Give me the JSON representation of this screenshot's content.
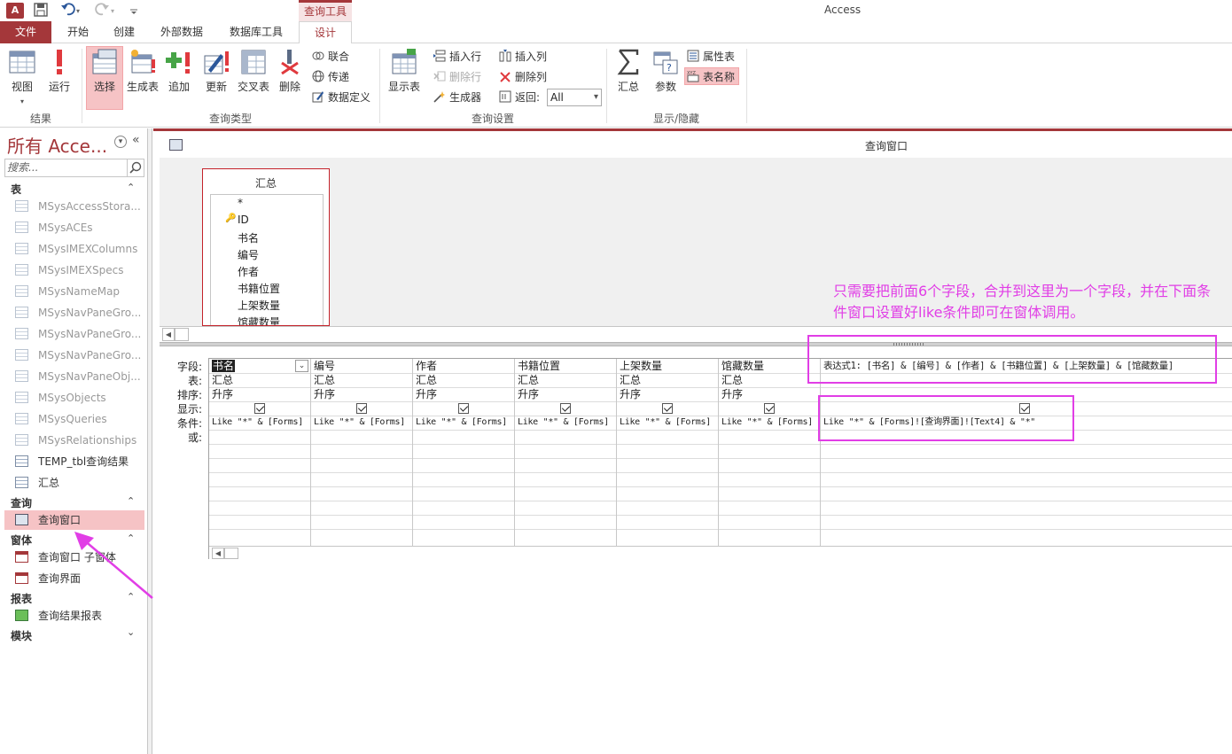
{
  "window": {
    "app_logo": "A",
    "title": "Access",
    "context_tab_header": "查询工具"
  },
  "quick_access": {
    "save_icon": "save-icon",
    "undo_icon": "undo-icon",
    "redo_icon": "redo-icon",
    "customize_icon": "customize-icon"
  },
  "tabs": [
    {
      "label": "文件"
    },
    {
      "label": "开始"
    },
    {
      "label": "创建"
    },
    {
      "label": "外部数据"
    },
    {
      "label": "数据库工具"
    },
    {
      "label": "设计"
    }
  ],
  "ribbon": {
    "results": {
      "label": "结果",
      "view": "视图",
      "run": "运行"
    },
    "query_type": {
      "label": "查询类型",
      "select": "选择",
      "make_table": "生成表",
      "append": "追加",
      "update": "更新",
      "crosstab": "交叉表",
      "delete": "删除",
      "union": "联合",
      "passthrough": "传递",
      "data_definition": "数据定义"
    },
    "query_setup": {
      "label": "查询设置",
      "show_table": "显示表",
      "insert_rows": "插入行",
      "delete_rows": "删除行",
      "builder": "生成器",
      "insert_columns": "插入列",
      "delete_columns": "删除列",
      "return_label": "返回:",
      "return_value": "All"
    },
    "show_hide": {
      "label": "显示/隐藏",
      "totals": "汇总",
      "parameters": "参数",
      "property_sheet": "属性表",
      "table_names": "表名称"
    }
  },
  "nav": {
    "title": "所有 Acce...",
    "search_placeholder": "搜索...",
    "sections": {
      "tables": "表",
      "queries": "查询",
      "forms": "窗体",
      "reports": "报表",
      "modules": "模块"
    },
    "tables": [
      "MSysAccessStora...",
      "MSysACEs",
      "MSysIMEXColumns",
      "MSysIMEXSpecs",
      "MSysNameMap",
      "MSysNavPaneGro...",
      "MSysNavPaneGro...",
      "MSysNavPaneGro...",
      "MSysNavPaneObj...",
      "MSysObjects",
      "MSysQueries",
      "MSysRelationships",
      "TEMP_tbl查询结果",
      "汇总"
    ],
    "queries": [
      "查询窗口"
    ],
    "forms": [
      "查询窗口 子窗体",
      "查询界面"
    ],
    "reports": [
      "查询结果报表"
    ]
  },
  "document": {
    "title": "查询窗口",
    "table_box": {
      "title": "汇总",
      "fields": [
        "*",
        "ID",
        "书名",
        "编号",
        "作者",
        "书籍位置",
        "上架数量",
        "馆藏数量"
      ]
    },
    "row_labels": [
      "字段:",
      "表:",
      "排序:",
      "显示:",
      "条件:",
      "或:"
    ],
    "columns": [
      {
        "field": "书名",
        "table": "汇总",
        "sort": "升序",
        "show": true,
        "criteria": "Like \"*\" & [Forms]"
      },
      {
        "field": "编号",
        "table": "汇总",
        "sort": "升序",
        "show": true,
        "criteria": "Like \"*\" & [Forms]"
      },
      {
        "field": "作者",
        "table": "汇总",
        "sort": "升序",
        "show": true,
        "criteria": "Like \"*\" & [Forms]"
      },
      {
        "field": "书籍位置",
        "table": "汇总",
        "sort": "升序",
        "show": true,
        "criteria": "Like \"*\" & [Forms]"
      },
      {
        "field": "上架数量",
        "table": "汇总",
        "sort": "升序",
        "show": true,
        "criteria": "Like \"*\" & [Forms]"
      },
      {
        "field": "馆藏数量",
        "table": "汇总",
        "sort": "升序",
        "show": true,
        "criteria": "Like \"*\" & [Forms]"
      },
      {
        "field": "表达式1: [书名] & [编号] & [作者] & [书籍位置] & [上架数量] & [馆藏数量]",
        "table": "",
        "sort": "",
        "show": true,
        "criteria": "Like \"*\" & [Forms]![查询界面]![Text4] & \"*\""
      }
    ]
  },
  "annotation": {
    "text": "只需要把前面6个字段，合并到这里为一个字段，并在下面条件窗口设置好like条件即可在窗体调用。",
    "color": "#e13ee6"
  },
  "colors": {
    "accent": "#a4373a",
    "selected_bg": "#f6c3c5",
    "annotation": "#e13ee6"
  }
}
